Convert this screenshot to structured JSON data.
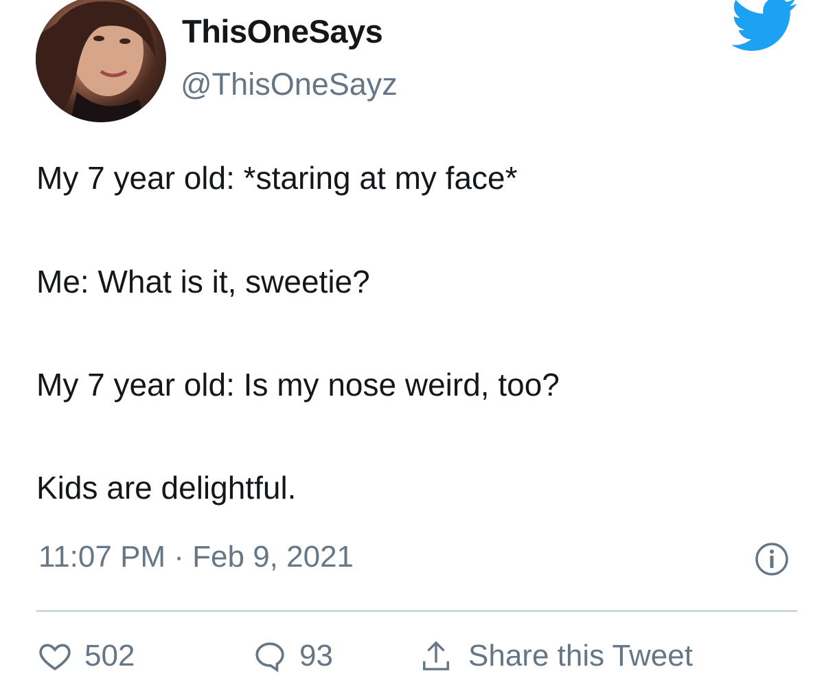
{
  "user": {
    "display_name": "ThisOneSays",
    "handle": "@ThisOneSayz"
  },
  "tweet": {
    "lines": [
      "My 7 year old: *staring at my face*",
      "Me: What is it, sweetie?",
      "My 7 year old: Is my nose weird, too?",
      "Kids are delightful."
    ],
    "timestamp": "11:07 PM · Feb 9, 2021"
  },
  "actions": {
    "likes": "502",
    "replies": "93",
    "share_label": "Share this Tweet"
  },
  "icons": {
    "brand": "twitter-bird-icon",
    "info": "info-icon",
    "like": "heart-icon",
    "reply": "reply-icon",
    "share": "share-icon"
  },
  "colors": {
    "brand_blue": "#1da1f2",
    "secondary_text": "#657786",
    "primary_text": "#14171a",
    "divider": "#ccd6dd"
  }
}
